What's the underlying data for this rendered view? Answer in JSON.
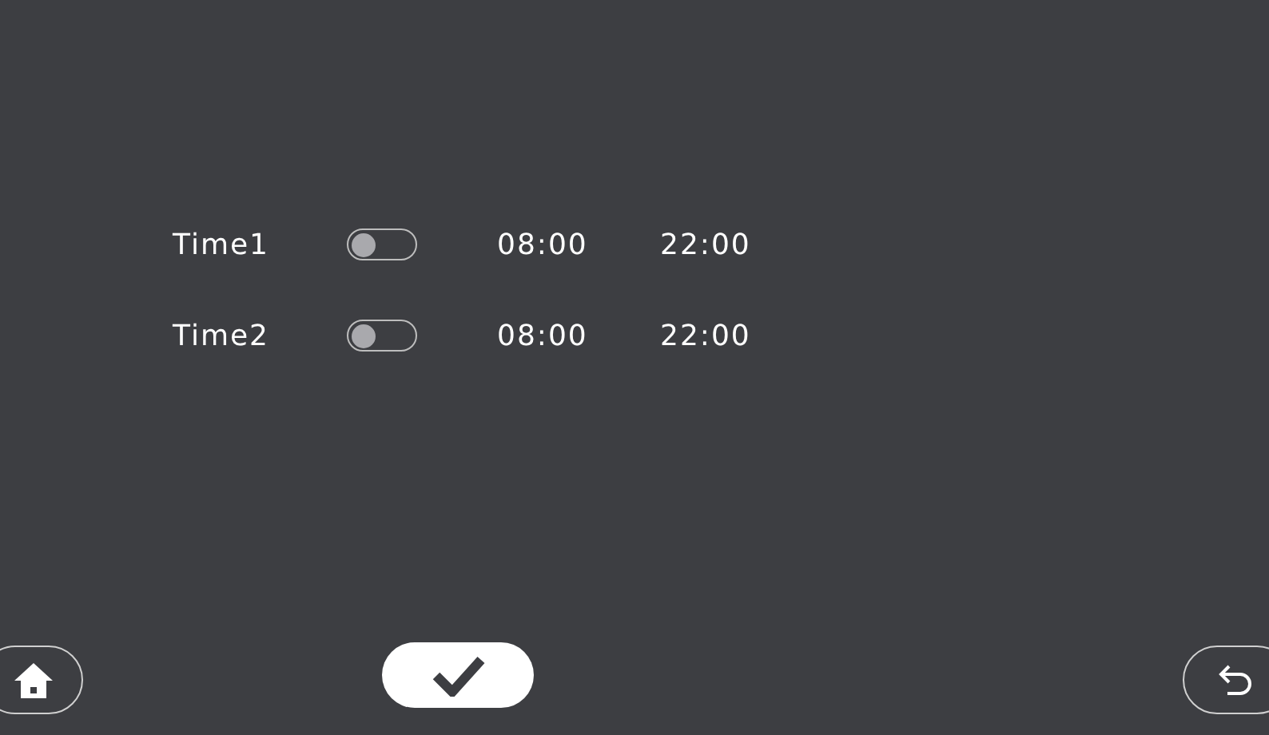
{
  "schedules": [
    {
      "label": "Time1",
      "on": false,
      "start": "08:00",
      "end": "22:00"
    },
    {
      "label": "Time2",
      "on": false,
      "start": "08:00",
      "end": "22:00"
    }
  ]
}
